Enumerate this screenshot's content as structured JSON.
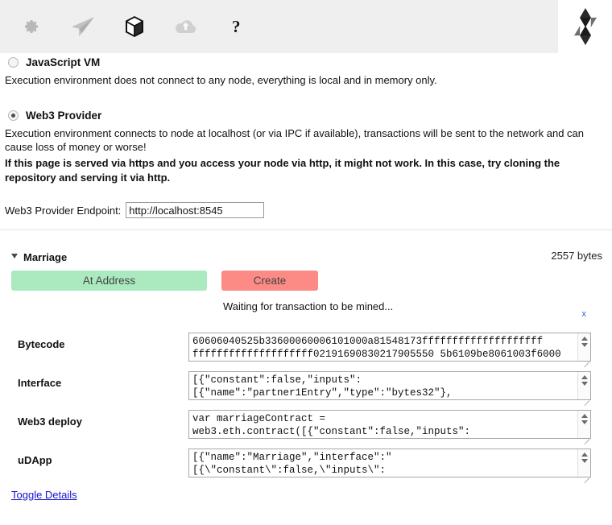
{
  "toolbar": {
    "icons": [
      {
        "name": "gear-icon",
        "label": "Settings"
      },
      {
        "name": "paper-plane-icon",
        "label": "Run"
      },
      {
        "name": "cube-icon",
        "label": "Compile"
      },
      {
        "name": "cloud-upload-icon",
        "label": "Publish"
      },
      {
        "name": "question-mark-icon",
        "label": "Help"
      }
    ],
    "logo": {
      "name": "solidity-logo",
      "label": "Solidity"
    }
  },
  "environment": {
    "options": [
      {
        "id": "javascript-vm",
        "label": "JavaScript VM",
        "selected": false,
        "description": "Execution environment does not connect to any node, everything is local and in memory only."
      },
      {
        "id": "web3-provider",
        "label": "Web3 Provider",
        "selected": true,
        "description": "Execution environment connects to node at localhost (or via IPC if available), transactions will be sent to the network and can cause loss of money or worse!",
        "warning": "If this page is served via https and you access your node via http, it might not work. In this case, try cloning the repository and serving it via http."
      }
    ],
    "endpoint": {
      "label": "Web3 Provider Endpoint:",
      "value": "http://localhost:8545",
      "placeholder": "http://localhost:8545"
    }
  },
  "contract": {
    "name": "Marriage",
    "size": "2557 bytes",
    "expanded": true,
    "buttons": {
      "at_address": "At Address",
      "create": "Create"
    },
    "status": {
      "text": "Waiting for transaction to be mined...",
      "close": "x"
    },
    "details": [
      {
        "label": "Bytecode",
        "value": "60606040525b33600060006101000a81548173ffffffffffffffffffff\nffffffffffffffffffff02191690830217905550 5b6109be8061003f6000"
      },
      {
        "label": "Interface",
        "value": "[{\"constant\":false,\"inputs\":\n[{\"name\":\"partner1Entry\",\"type\":\"bytes32\"},"
      },
      {
        "label": "Web3 deploy",
        "value": "var marriageContract =\nweb3.eth.contract([{\"constant\":false,\"inputs\":"
      },
      {
        "label": "uDApp",
        "value": "[{\"name\":\"Marriage\",\"interface\":\"\n[{\\\"constant\\\":false,\\\"inputs\\\":"
      }
    ],
    "toggle_details": "Toggle Details"
  },
  "colors": {
    "toolbar_bg": "#efefef",
    "at_address_bg": "#aaeabe",
    "create_bg": "#fb8b84",
    "link": "#1414cc"
  }
}
